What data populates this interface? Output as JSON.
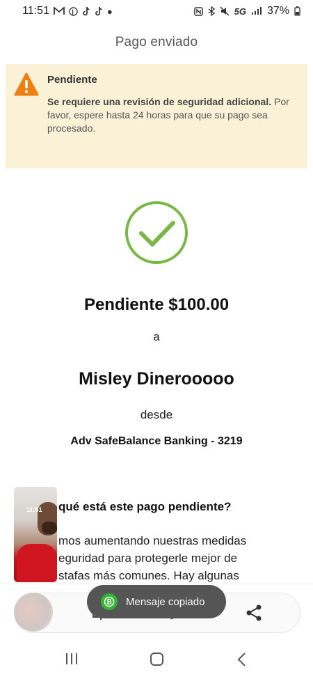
{
  "status_bar": {
    "time": "11:51",
    "notification_icons": [
      "gmail-icon",
      "pinterest-icon",
      "tiktok-icon",
      "tiktok-icon",
      "dot-icon"
    ],
    "system_icons": [
      "nfc-icon",
      "bluetooth-icon",
      "mute-icon",
      "5g-icon",
      "signal-icon"
    ],
    "network": "5G",
    "battery": "37%"
  },
  "header": {
    "title": "Pago enviado"
  },
  "alert": {
    "title": "Pendiente",
    "body_bold": "Se requiere una revisión de seguridad adicional.",
    "body_rest": " Por favor, espere hasta 24 horas para que su pago sea procesado.",
    "colors": {
      "background": "#faf1d7",
      "icon": "#f07f12"
    }
  },
  "status_icon": {
    "icon": "checkmark-circle-icon",
    "color": "#7ab648"
  },
  "payment": {
    "amount": "Pendiente $100.00",
    "to_label": "a",
    "recipient": "Misley Dinerooooo",
    "from_label": "desde",
    "account": "Adv SafeBalance Banking - 3219"
  },
  "info": {
    "title": "qué está este pago pendiente?",
    "lines": [
      "mos aumentando nuestras medidas",
      "eguridad para protegerle mejor de",
      "stafas más comunes. Hay algunas"
    ]
  },
  "video_overlay": {
    "time": "11:51"
  },
  "bottom_panel": {
    "icons": [
      "crop-icon",
      "edit-icon",
      "share-icon"
    ]
  },
  "toast": {
    "text": "Mensaje copiado",
    "icon": "whatsapp-business-icon",
    "icon_color": "#34b535"
  },
  "nav_bar": {
    "buttons": [
      "recents-icon",
      "home-icon",
      "back-icon"
    ]
  }
}
